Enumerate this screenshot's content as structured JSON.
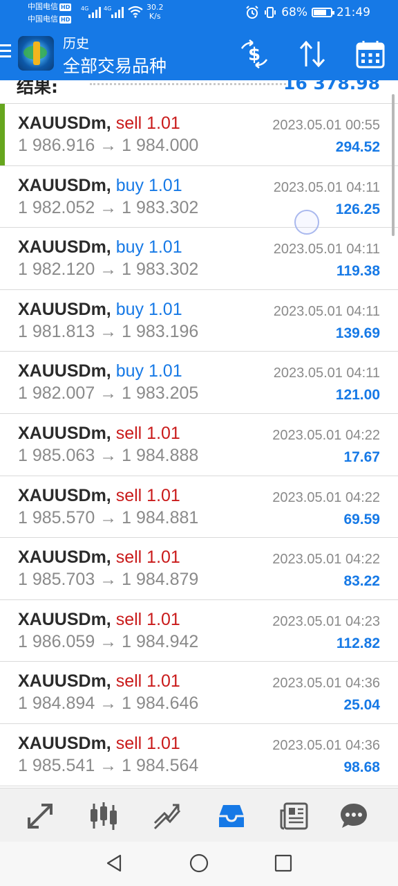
{
  "status_bar": {
    "carrier1": "中国电信",
    "carrier2": "中国电信",
    "hd": "HD",
    "network1": "4G",
    "network2": "4G",
    "speed_value": "30.2",
    "speed_unit": "K/s",
    "battery": "68%",
    "time": "21:49"
  },
  "header": {
    "title": "历史",
    "subtitle": "全部交易品种",
    "accent": "#1679e6"
  },
  "summary": {
    "label": "结果:",
    "value": "16 378.98"
  },
  "trades": [
    {
      "symbol": "XAUUSDm,",
      "side": "sell 1.01",
      "type": "sell",
      "prices": "1 986.916 → 1 984.000",
      "datetime": "2023.05.01 00:55",
      "profit": "294.52"
    },
    {
      "symbol": "XAUUSDm,",
      "side": "buy 1.01",
      "type": "buy",
      "prices": "1 982.052 → 1 983.302",
      "datetime": "2023.05.01 04:11",
      "profit": "126.25"
    },
    {
      "symbol": "XAUUSDm,",
      "side": "buy 1.01",
      "type": "buy",
      "prices": "1 982.120 → 1 983.302",
      "datetime": "2023.05.01 04:11",
      "profit": "119.38"
    },
    {
      "symbol": "XAUUSDm,",
      "side": "buy 1.01",
      "type": "buy",
      "prices": "1 981.813 → 1 983.196",
      "datetime": "2023.05.01 04:11",
      "profit": "139.69"
    },
    {
      "symbol": "XAUUSDm,",
      "side": "buy 1.01",
      "type": "buy",
      "prices": "1 982.007 → 1 983.205",
      "datetime": "2023.05.01 04:11",
      "profit": "121.00"
    },
    {
      "symbol": "XAUUSDm,",
      "side": "sell 1.01",
      "type": "sell",
      "prices": "1 985.063 → 1 984.888",
      "datetime": "2023.05.01 04:22",
      "profit": "17.67"
    },
    {
      "symbol": "XAUUSDm,",
      "side": "sell 1.01",
      "type": "sell",
      "prices": "1 985.570 → 1 984.881",
      "datetime": "2023.05.01 04:22",
      "profit": "69.59"
    },
    {
      "symbol": "XAUUSDm,",
      "side": "sell 1.01",
      "type": "sell",
      "prices": "1 985.703 → 1 984.879",
      "datetime": "2023.05.01 04:22",
      "profit": "83.22"
    },
    {
      "symbol": "XAUUSDm,",
      "side": "sell 1.01",
      "type": "sell",
      "prices": "1 986.059 → 1 984.942",
      "datetime": "2023.05.01 04:23",
      "profit": "112.82"
    },
    {
      "symbol": "XAUUSDm,",
      "side": "sell 1.01",
      "type": "sell",
      "prices": "1 984.894 → 1 984.646",
      "datetime": "2023.05.01 04:36",
      "profit": "25.04"
    },
    {
      "symbol": "XAUUSDm,",
      "side": "sell 1.01",
      "type": "sell",
      "prices": "1 985.541 → 1 984.564",
      "datetime": "2023.05.01 04:36",
      "profit": "98.68"
    }
  ],
  "tabs": [
    {
      "icon": "quotes-icon"
    },
    {
      "icon": "chart-icon"
    },
    {
      "icon": "trade-icon"
    },
    {
      "icon": "history-icon",
      "active": true
    },
    {
      "icon": "news-icon"
    },
    {
      "icon": "chat-icon"
    }
  ],
  "nav": [
    {
      "icon": "back-icon"
    },
    {
      "icon": "home-icon"
    },
    {
      "icon": "recents-icon"
    }
  ]
}
